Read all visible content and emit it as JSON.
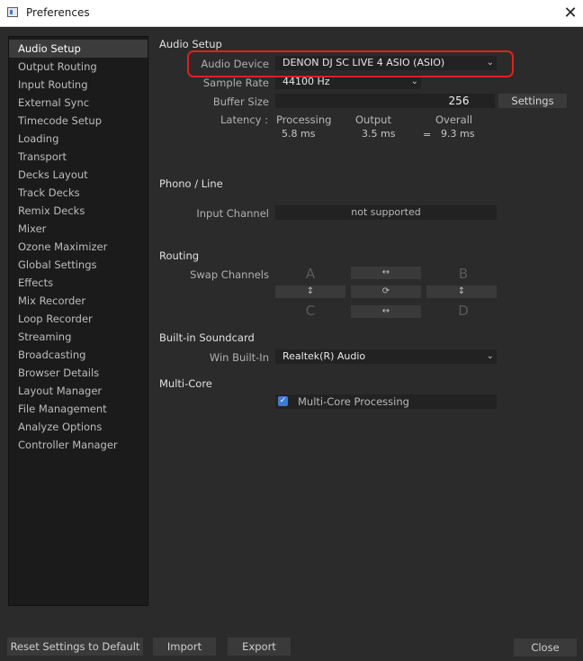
{
  "window": {
    "title": "Preferences",
    "close_glyph": "✕"
  },
  "nav": {
    "items": [
      {
        "label": "Audio Setup",
        "selected": true
      },
      {
        "label": "Output Routing"
      },
      {
        "label": "Input Routing"
      },
      {
        "label": "External Sync"
      },
      {
        "label": "Timecode Setup"
      },
      {
        "label": "Loading"
      },
      {
        "label": "Transport"
      },
      {
        "label": "Decks Layout"
      },
      {
        "label": "Track Decks"
      },
      {
        "label": "Remix Decks"
      },
      {
        "label": "Mixer"
      },
      {
        "label": "Ozone Maximizer"
      },
      {
        "label": "Global Settings"
      },
      {
        "label": "Effects"
      },
      {
        "label": "Mix Recorder"
      },
      {
        "label": "Loop Recorder"
      },
      {
        "label": "Streaming"
      },
      {
        "label": "Broadcasting"
      },
      {
        "label": "Browser Details"
      },
      {
        "label": "Layout Manager"
      },
      {
        "label": "File Management"
      },
      {
        "label": "Analyze Options"
      },
      {
        "label": "Controller Manager"
      }
    ]
  },
  "audio_setup": {
    "heading": "Audio Setup",
    "device_label": "Audio Device",
    "device_value": "DENON DJ SC LIVE 4 ASIO (ASIO)",
    "sample_rate_label": "Sample Rate",
    "sample_rate_value": "44100 Hz",
    "buffer_size_label": "Buffer Size",
    "buffer_size_value": "256",
    "settings_label": "Settings",
    "latency_label": "Latency :",
    "processing_label": "Processing",
    "processing_value": "5.8 ms",
    "output_label": "Output",
    "output_value": "3.5 ms",
    "equals": "=",
    "overall_label": "Overall",
    "overall_value": "9.3 ms"
  },
  "phono": {
    "heading": "Phono / Line",
    "input_channel_label": "Input Channel",
    "input_channel_value": "not supported"
  },
  "routing": {
    "heading": "Routing",
    "swap_label": "Swap Channels",
    "letters": {
      "a": "A",
      "b": "B",
      "c": "C",
      "d": "D"
    },
    "glyph_horizontal": "↔",
    "glyph_vertical": "↕",
    "glyph_rotate": "⟳"
  },
  "soundcard": {
    "heading": "Built-in Soundcard",
    "win_label": "Win Built-In",
    "win_value": "Realtek(R) Audio"
  },
  "multicore": {
    "heading": "Multi-Core",
    "checkbox_label": "Multi-Core Processing",
    "checked": true,
    "check_glyph": "✓"
  },
  "footer": {
    "reset_label": "Reset Settings to Default",
    "import_label": "Import",
    "export_label": "Export",
    "close_label": "Close"
  },
  "icons": {
    "app": "preferences-window-icon",
    "dropdown": "chevron-down-icon"
  },
  "colors": {
    "accent": "#3d7bd6",
    "highlight": "#e02020",
    "background": "#2b2b2b"
  }
}
